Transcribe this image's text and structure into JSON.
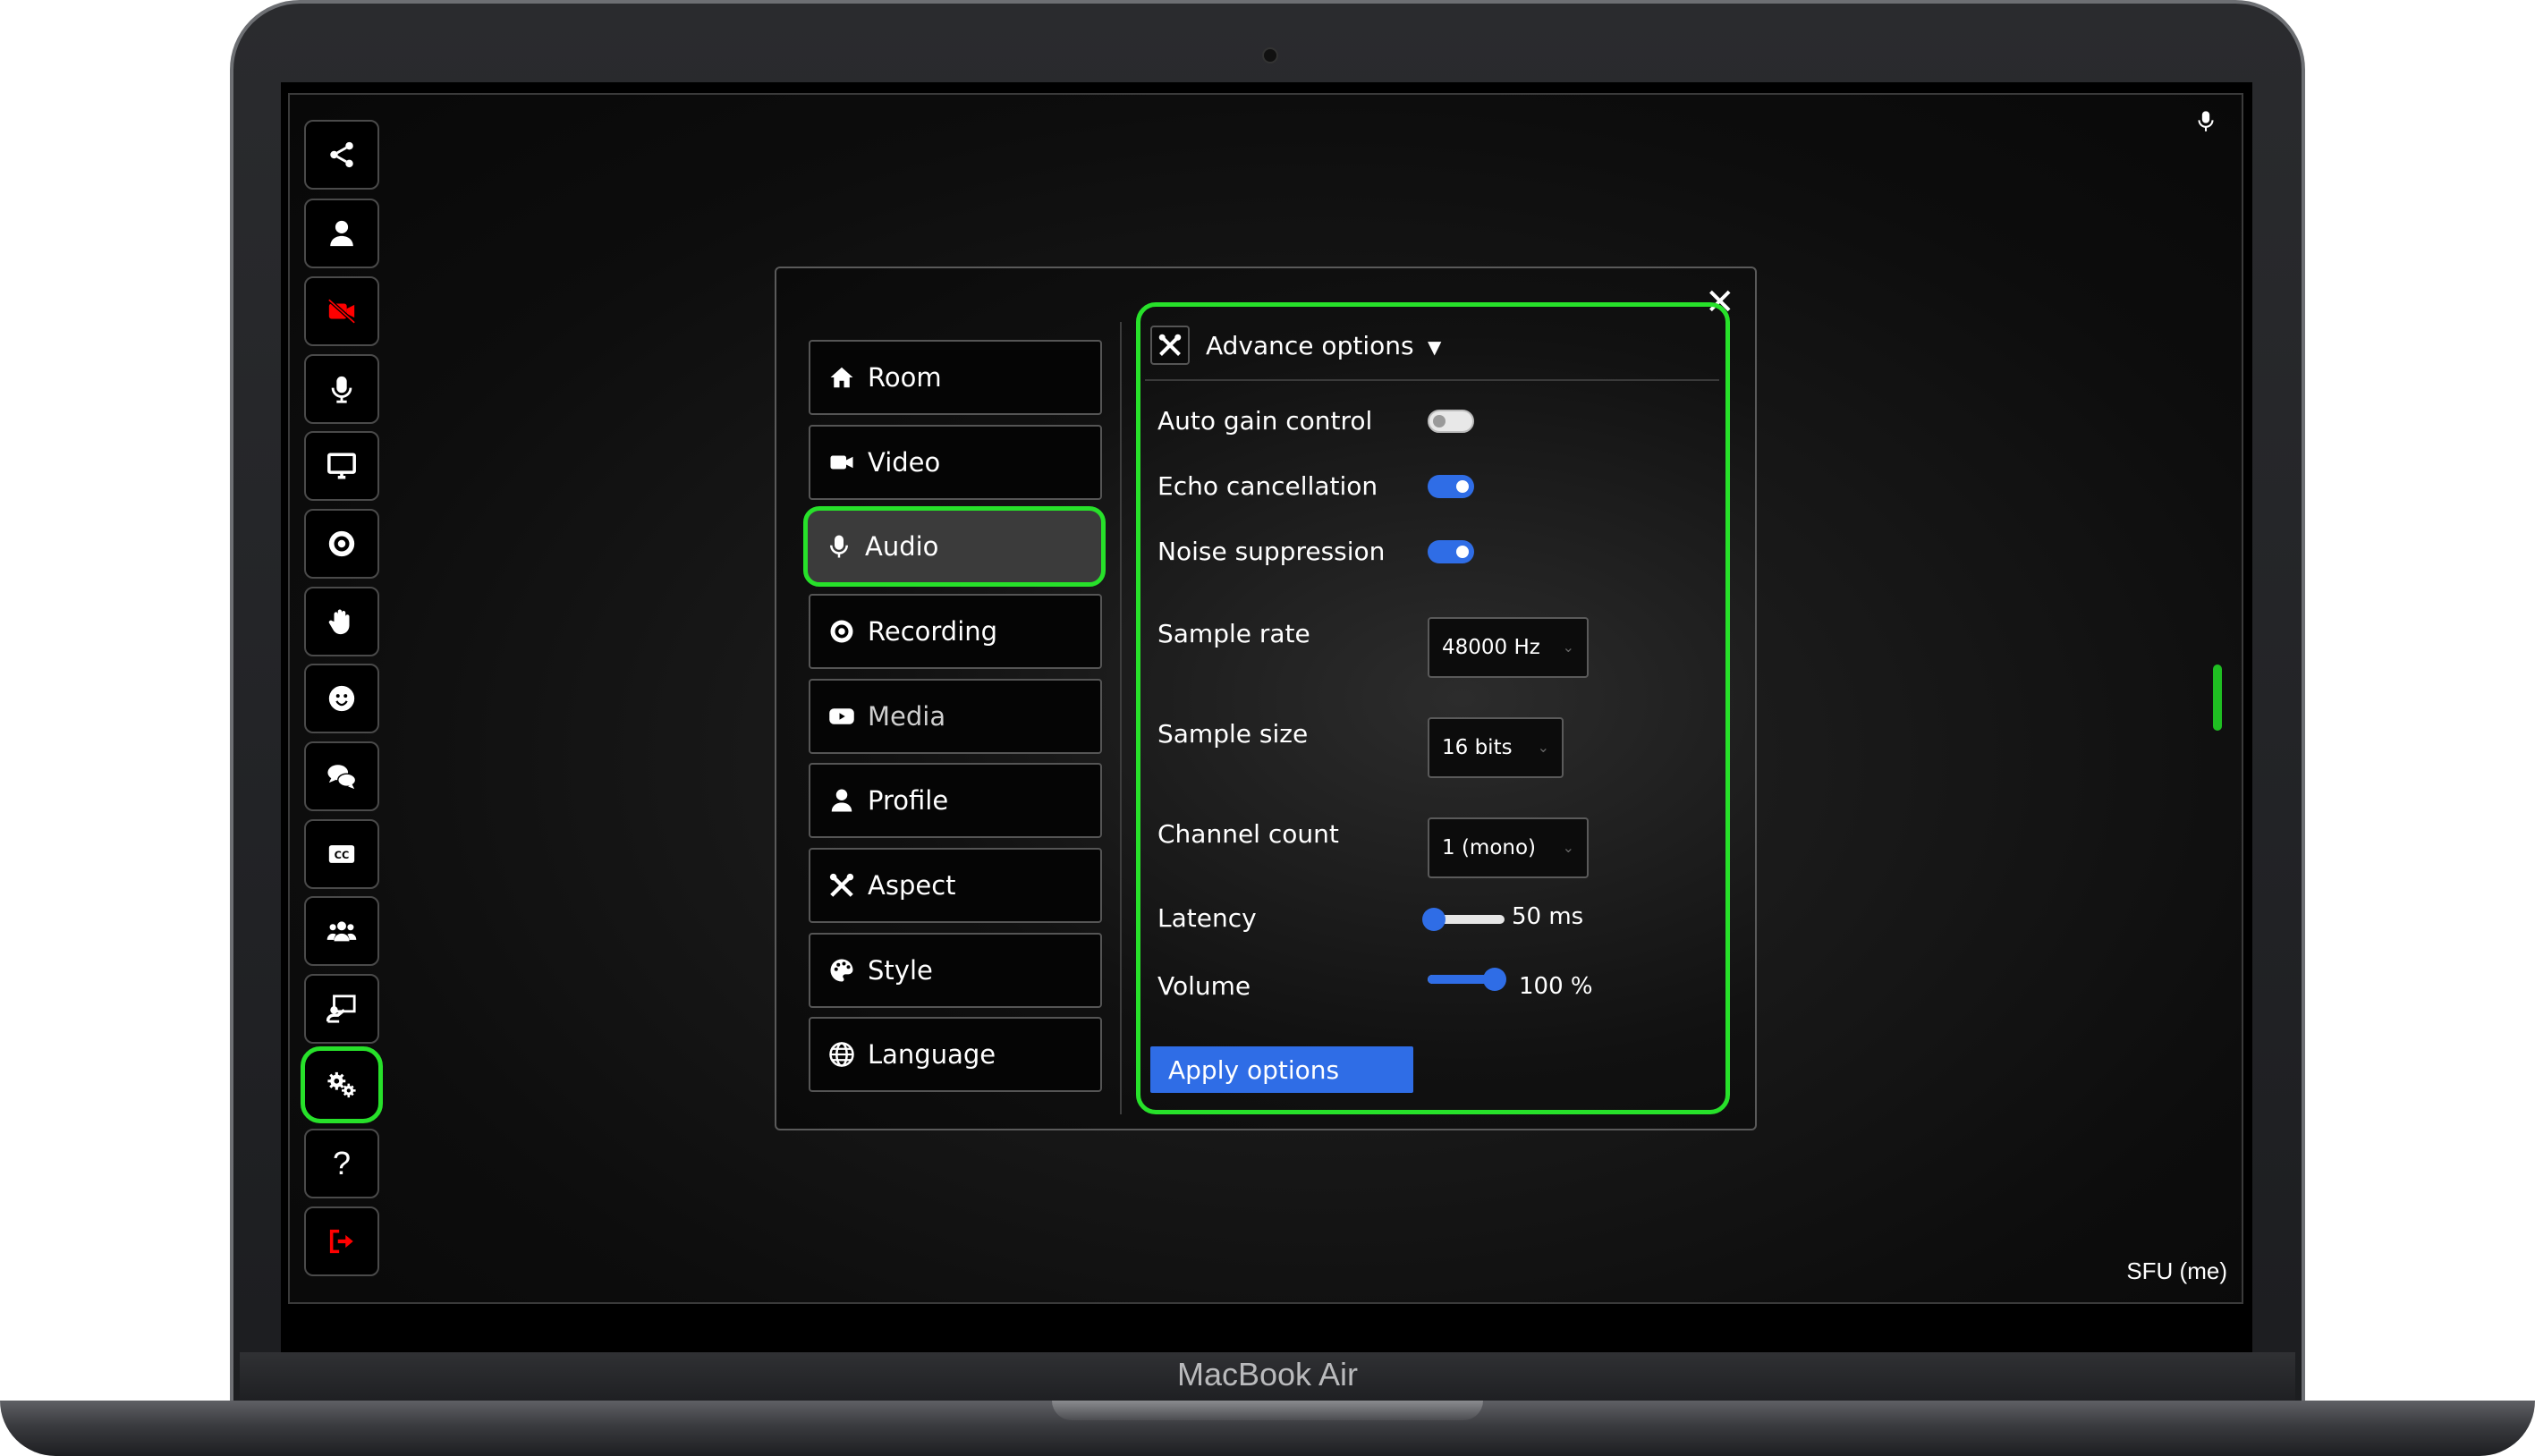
{
  "device": {
    "model_label": "MacBook Air"
  },
  "sidebar": {
    "buttons": [
      {
        "name": "share-button",
        "icon": "share-icon",
        "color": "#ffffff"
      },
      {
        "name": "participant-button",
        "icon": "user-icon",
        "color": "#ffffff"
      },
      {
        "name": "camera-off-button",
        "icon": "video-slash-icon",
        "color": "#ff0000"
      },
      {
        "name": "microphone-button",
        "icon": "microphone-icon",
        "color": "#ffffff"
      },
      {
        "name": "screen-share-button",
        "icon": "desktop-icon",
        "color": "#ffffff"
      },
      {
        "name": "record-button",
        "icon": "record-icon",
        "color": "#ffffff"
      },
      {
        "name": "raise-hand-button",
        "icon": "hand-icon",
        "color": "#ffffff"
      },
      {
        "name": "emoji-button",
        "icon": "smile-icon",
        "color": "#ffffff"
      },
      {
        "name": "chat-button",
        "icon": "comments-icon",
        "color": "#ffffff"
      },
      {
        "name": "captions-button",
        "icon": "closed-captions-icon",
        "color": "#ffffff"
      },
      {
        "name": "participants-button",
        "icon": "users-icon",
        "color": "#ffffff"
      },
      {
        "name": "whiteboard-button",
        "icon": "chalkboard-icon",
        "color": "#ffffff"
      },
      {
        "name": "settings-button",
        "icon": "cogs-icon",
        "color": "#ffffff",
        "highlighted": true
      },
      {
        "name": "help-button",
        "icon": "question-icon",
        "text": "?",
        "color": "#ffffff"
      },
      {
        "name": "leave-button",
        "icon": "sign-out-icon",
        "color": "#ff0000"
      }
    ]
  },
  "status": {
    "sfu_label": "SFU (me)"
  },
  "settings": {
    "nav": [
      {
        "label": "Room",
        "icon": "home-icon"
      },
      {
        "label": "Video",
        "icon": "video-icon"
      },
      {
        "label": "Audio",
        "icon": "microphone-icon",
        "active": true
      },
      {
        "label": "Recording",
        "icon": "record-icon"
      },
      {
        "label": "Media",
        "icon": "youtube-icon"
      },
      {
        "label": "Profile",
        "icon": "user-icon"
      },
      {
        "label": "Aspect",
        "icon": "tools-icon"
      },
      {
        "label": "Style",
        "icon": "palette-icon"
      },
      {
        "label": "Language",
        "icon": "globe-icon"
      }
    ],
    "advanced": {
      "title": "Advance options",
      "auto_gain": {
        "label": "Auto gain control",
        "enabled": false
      },
      "echo": {
        "label": "Echo cancellation",
        "enabled": true
      },
      "noise": {
        "label": "Noise suppression",
        "enabled": true
      },
      "sample_rate": {
        "label": "Sample rate",
        "value": "48000 Hz"
      },
      "sample_size": {
        "label": "Sample size",
        "value": "16 bits"
      },
      "channel_count": {
        "label": "Channel count",
        "value": "1 (mono)"
      },
      "latency": {
        "label": "Latency",
        "value_text": "50 ms",
        "fraction": 0.0
      },
      "volume": {
        "label": "Volume",
        "value_text": "100 %",
        "fraction": 1.0
      },
      "apply_label": "Apply options"
    }
  },
  "colors": {
    "accent": "#2f6de6",
    "highlight": "#27e12a",
    "danger": "#ff0000"
  }
}
